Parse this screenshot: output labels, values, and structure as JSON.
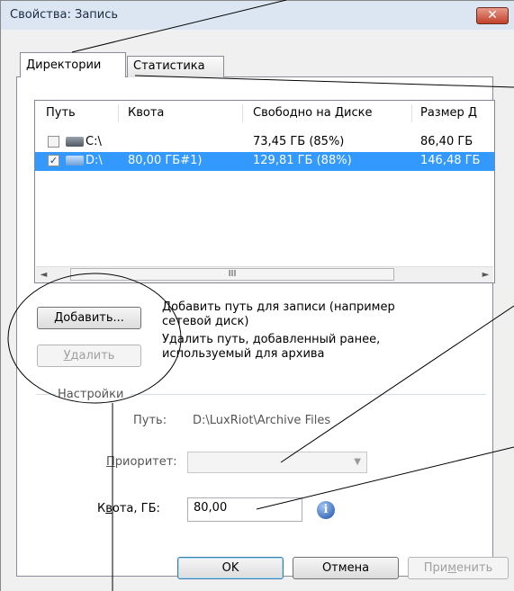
{
  "window": {
    "title": "Свойства: Запись",
    "close_glyph": "✕"
  },
  "tabs": [
    {
      "label": "Директории",
      "active": true
    },
    {
      "label": "Статистика",
      "active": false
    }
  ],
  "list": {
    "columns": [
      "Путь",
      "Квота",
      "Свободно на Диске",
      "Размер Д"
    ],
    "rows": [
      {
        "checked": false,
        "path": "C:\\",
        "quota": "",
        "free": "73,45 ГБ (85%)",
        "size": "86,40 ГБ",
        "selected": false
      },
      {
        "checked": true,
        "path": "D:\\",
        "quota": "80,00 ГБ#1)",
        "free": "129,81 ГБ (88%)",
        "size": "146,48 ГБ",
        "selected": true
      }
    ],
    "scroll_left": "◄",
    "scroll_right": "►",
    "thumb_grip": "III"
  },
  "buttons": {
    "add_hotkey": "Д",
    "add_rest": "обавить...",
    "remove_hotkey": "У",
    "remove_rest": "далить",
    "ok": "OK",
    "cancel": "Отмена",
    "apply_prefix": "При",
    "apply_hotkey": "м",
    "apply_rest": "енить"
  },
  "descriptions": {
    "add": "Добавить путь для записи (например сетевой диск)",
    "remove": "Удалить путь, добавленный ранее, используемый для архива"
  },
  "settings": {
    "group_label": "Настройки",
    "path_label": "Путь:",
    "path_value": "D:\\LuxRiot\\Archive Files",
    "priority_hotkey": "П",
    "priority_rest": "риоритет:",
    "priority_value": "",
    "quota_prefix": "К",
    "quota_hotkey": "в",
    "quota_rest": "ота, ГБ:",
    "quota_value": "80,00",
    "info_glyph": "i"
  },
  "icons": [
    "checkbox-icon",
    "hard-drive-icon",
    "info-icon",
    "dropdown-arrow-icon",
    "close-icon"
  ]
}
